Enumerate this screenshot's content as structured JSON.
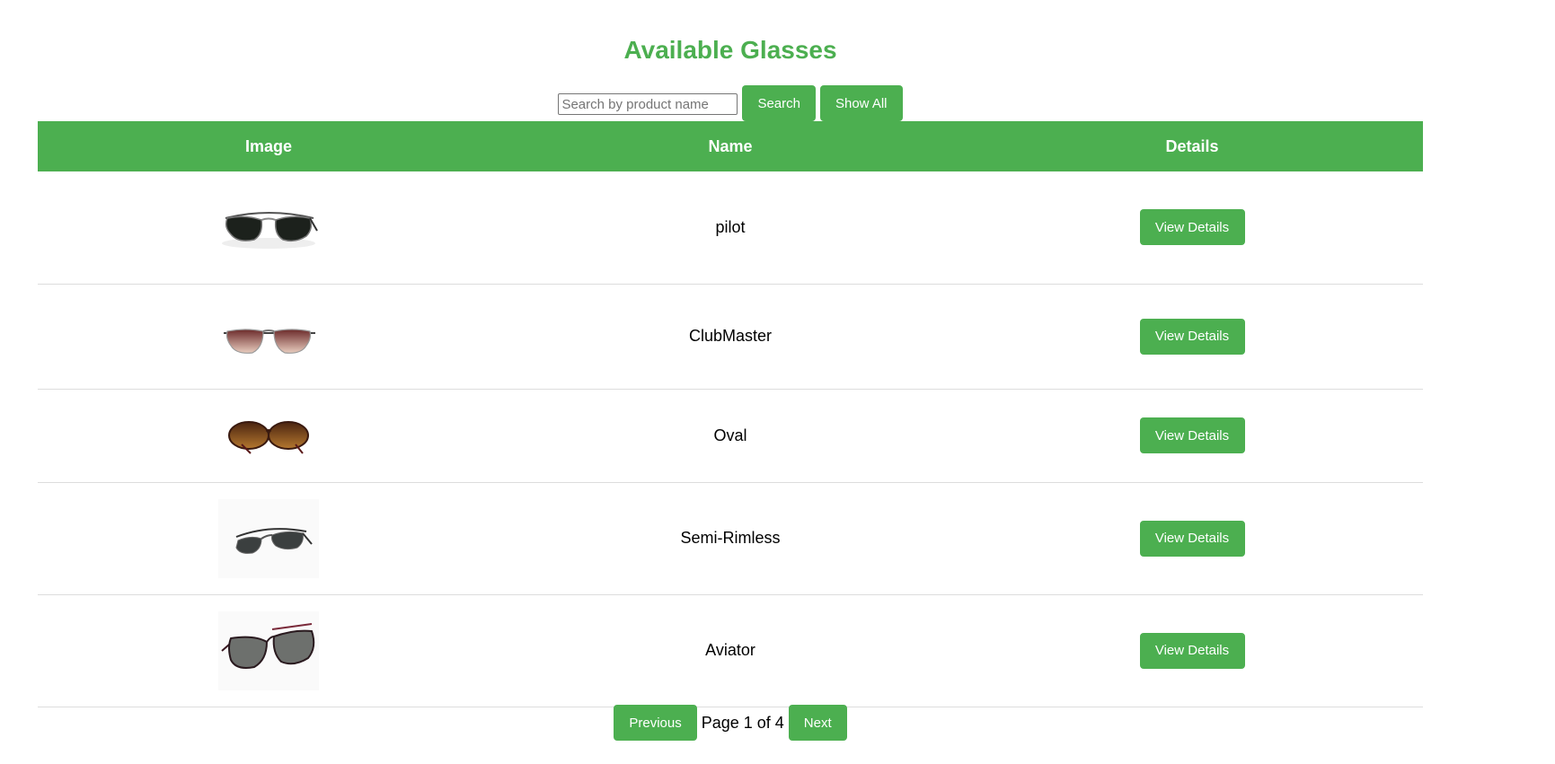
{
  "title": "Available Glasses",
  "search": {
    "placeholder": "Search by product name",
    "value": "",
    "search_label": "Search",
    "show_all_label": "Show All"
  },
  "table": {
    "headers": [
      "Image",
      "Name",
      "Details"
    ],
    "rows": [
      {
        "name": "pilot",
        "button": "View Details",
        "image": "aviator-sunglasses-dark-image"
      },
      {
        "name": "ClubMaster",
        "button": "View Details",
        "image": "gradient-aviator-sunglasses-image"
      },
      {
        "name": "Oval",
        "button": "View Details",
        "image": "oval-brown-sunglasses-image"
      },
      {
        "name": "Semi-Rimless",
        "button": "View Details",
        "image": "semi-rimless-sunglasses-image"
      },
      {
        "name": "Aviator",
        "button": "View Details",
        "image": "rectangular-wire-sunglasses-image"
      }
    ]
  },
  "pagination": {
    "previous_label": "Previous",
    "page_text": "Page 1 of 4",
    "next_label": "Next"
  },
  "colors": {
    "accent": "#4caf50",
    "text": "#000000",
    "divider": "#dddddd"
  }
}
